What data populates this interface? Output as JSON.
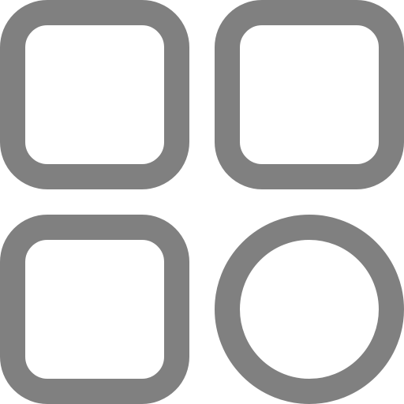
{
  "icon": {
    "name": "apps-grid-icon",
    "color": "#808080",
    "background": "#ffffff",
    "tiles": [
      {
        "name": "tile-top-left",
        "shape": "rounded-square"
      },
      {
        "name": "tile-top-right",
        "shape": "rounded-square"
      },
      {
        "name": "tile-bottom-left",
        "shape": "rounded-square"
      },
      {
        "name": "tile-bottom-right",
        "shape": "circle"
      }
    ]
  }
}
